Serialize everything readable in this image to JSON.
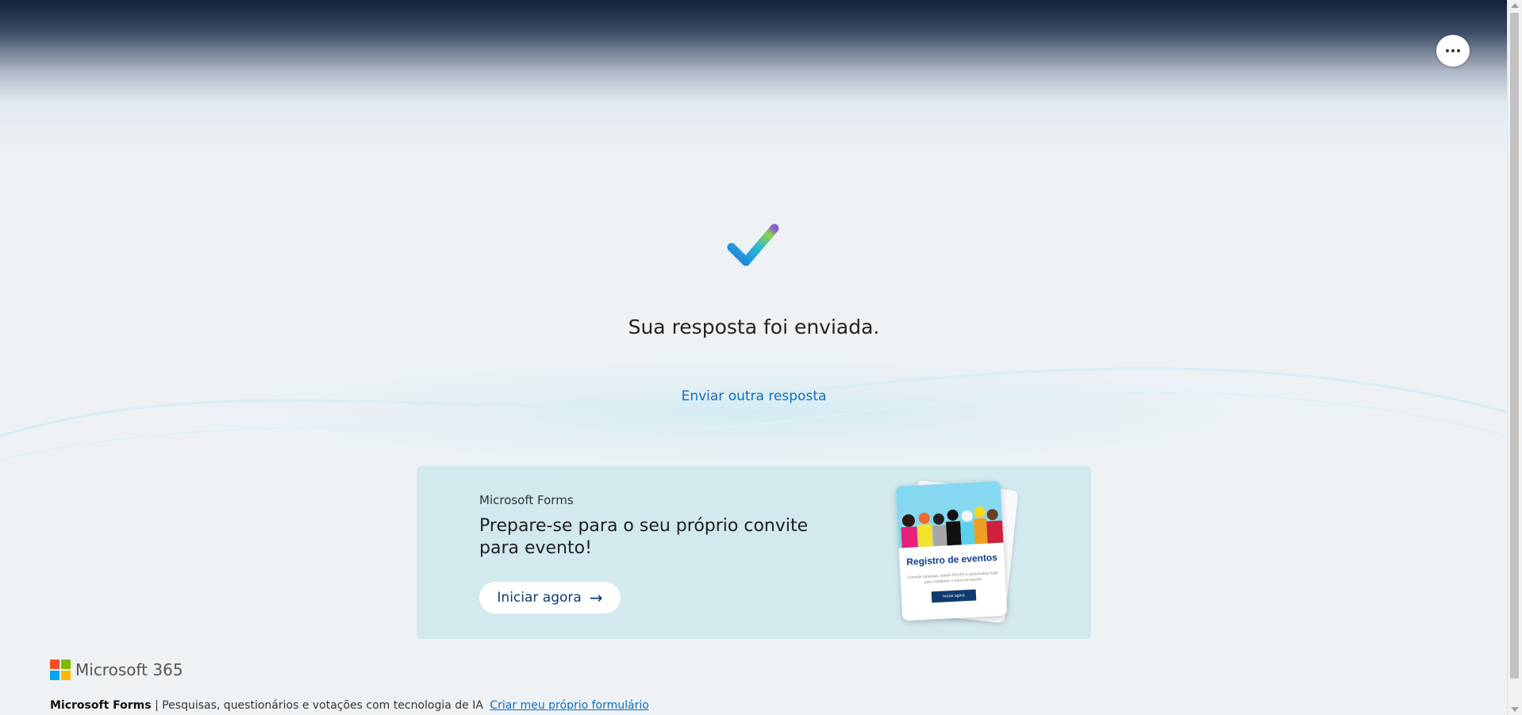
{
  "header": {
    "more_button": "...",
    "more_icon": "ellipsis-icon"
  },
  "confirmation": {
    "icon": "checkmark-icon",
    "title": "Sua resposta foi enviada.",
    "submit_another": "Enviar outra resposta"
  },
  "promo": {
    "brand": "Microsoft Forms",
    "headline": "Prepare-se para o seu próprio convite para evento!",
    "cta_label": "Iniciar agora",
    "cta_icon": "arrow-right-icon",
    "card": {
      "title": "Registro de eventos",
      "text": "Convide pessoas, colete RSVPs e personalize tudo para combinar o tema do evento",
      "button": "Iniciar agora"
    }
  },
  "footer": {
    "logo_text": "Microsoft 365",
    "logo_colors": [
      "#f25022",
      "#7fba00",
      "#00a4ef",
      "#ffb900"
    ],
    "product": "Microsoft Forms",
    "separator": "|",
    "tagline": "Pesquisas, questionários e votações com tecnologia de IA",
    "create_link": "Criar meu próprio formulário"
  },
  "colors": {
    "link": "#0f6cbd",
    "promo_bg": "#cde8ec",
    "header_dark": "#142038"
  }
}
